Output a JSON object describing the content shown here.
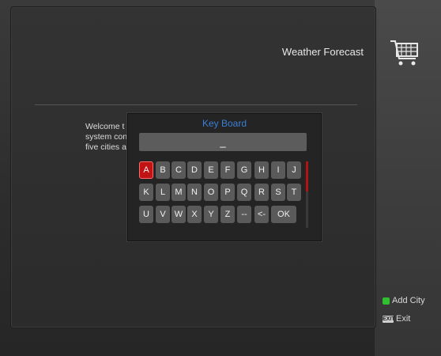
{
  "header": {
    "title": "Weather Forecast"
  },
  "welcome": {
    "lines": [
      "Welcome t",
      "system con",
      "five cities a"
    ]
  },
  "keyboard": {
    "title": "Key Board",
    "input_value": "_",
    "rows": [
      [
        "A",
        "B",
        "C",
        "D",
        "E",
        "F",
        "G",
        "H",
        "I",
        "J"
      ],
      [
        "K",
        "L",
        "M",
        "N",
        "O",
        "P",
        "Q",
        "R",
        "S",
        "T"
      ],
      [
        "U",
        "V",
        "W",
        "X",
        "Y",
        "Z",
        "--",
        "<-",
        "OK"
      ]
    ],
    "selected_key": "A"
  },
  "legend": {
    "add_city_label": "Add City",
    "exit_label": "Exit",
    "exit_key_label": "EXIT",
    "add_city_color": "#2fbf2f"
  },
  "colors": {
    "accent": "#c01414",
    "title_blue": "#3b7fd6"
  }
}
